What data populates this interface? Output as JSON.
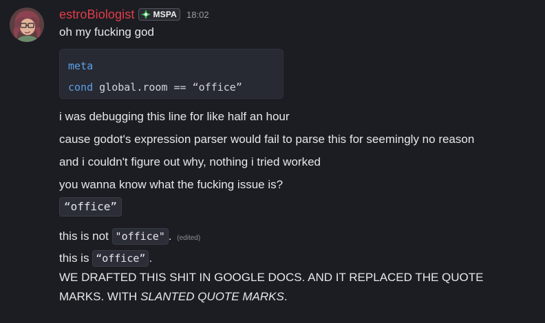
{
  "message": {
    "author": {
      "username": "estroBiologist",
      "username_color": "#e23d4b",
      "role_badge": {
        "icon": "mspa-badge-icon",
        "label": "MSPA"
      },
      "avatar": "user-avatar"
    },
    "timestamp": "18:02",
    "first_line": "oh my fucking god",
    "code_block": {
      "line1_keyword": "meta",
      "line2_keyword": "cond",
      "line2_code": "global.room == “office”"
    },
    "lines": [
      "i was debugging this line for like half an hour",
      "cause godot's expression parser would fail to parse this for seemingly no reason",
      "and i couldn't figure out why, nothing i tried worked",
      "you wanna know what the fucking issue is?"
    ],
    "standalone_code": "“office”",
    "not_line": {
      "prefix": "this is not ",
      "code": "\"office\"",
      "suffix": ".",
      "edited": "(edited)"
    },
    "is_line": {
      "prefix": "this is ",
      "code": "“office”",
      "suffix": "."
    },
    "final": {
      "line1": "WE DRAFTED THIS SHIT IN GOOGLE DOCS. AND IT REPLACED THE QUOTE",
      "line2_prefix": "MARKS. WITH ",
      "line2_italic": "SLANTED QUOTE MARKS",
      "line2_suffix": "."
    }
  },
  "colors": {
    "background": "#1c1d22",
    "code_keyword": "#5ea0e6",
    "code_block_bg": "#272a33"
  }
}
